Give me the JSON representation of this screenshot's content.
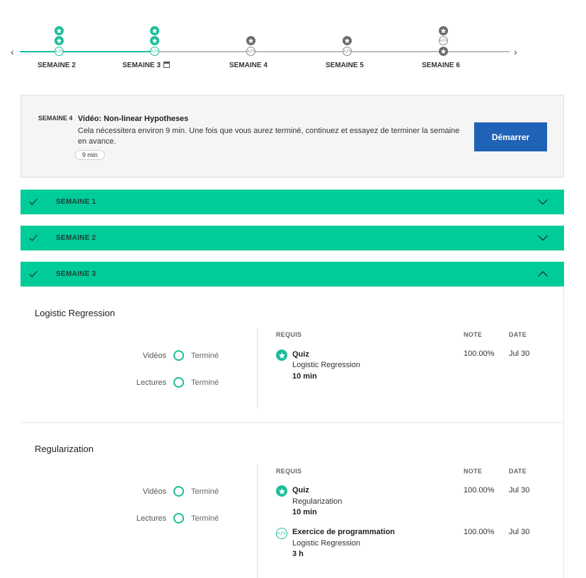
{
  "timeline": {
    "weeks": [
      {
        "label": "SEMAINE 2",
        "status": "done"
      },
      {
        "label": "SEMAINE 3",
        "status": "current"
      },
      {
        "label": "SEMAINE 4",
        "status": "todo"
      },
      {
        "label": "SEMAINE 5",
        "status": "todo"
      },
      {
        "label": "SEMAINE 6",
        "status": "todo"
      }
    ],
    "prev_arrow": "‹",
    "next_arrow": "›"
  },
  "next_item": {
    "week": "SEMAINE 4",
    "title": "Vidéo: Non-linear Hypotheses",
    "description": "Cela nécessitera environ 9  min. Une fois que vous aurez terminé, continuez et essayez de terminer la semaine en avance.",
    "duration": "9  min",
    "start_button": "Démarrer"
  },
  "weeks": [
    {
      "label": "SEMAINE 1",
      "expanded": false
    },
    {
      "label": "SEMAINE 2",
      "expanded": false
    },
    {
      "label": "SEMAINE 3",
      "expanded": true
    }
  ],
  "lessons": [
    {
      "title": "Logistic Regression",
      "progress": [
        {
          "label": "Vidéos",
          "status": "Terminé"
        },
        {
          "label": "Lectures",
          "status": "Terminé"
        }
      ],
      "headers": {
        "required": "REQUIS",
        "grade": "NOTE",
        "date": "DATE"
      },
      "items": [
        {
          "icon": "quiz-star-icon",
          "type": "Quiz",
          "name": "Logistic Regression",
          "duration": "10  min",
          "grade": "100.00%",
          "date": "Jul 30"
        }
      ]
    },
    {
      "title": "Regularization",
      "progress": [
        {
          "label": "Vidéos",
          "status": "Terminé"
        },
        {
          "label": "Lectures",
          "status": "Terminé"
        }
      ],
      "headers": {
        "required": "REQUIS",
        "grade": "NOTE",
        "date": "DATE"
      },
      "items": [
        {
          "icon": "quiz-star-icon",
          "type": "Quiz",
          "name": "Regularization",
          "duration": "10  min",
          "grade": "100.00%",
          "date": "Jul 30"
        },
        {
          "icon": "code-icon",
          "type": "Exercice de programmation",
          "name": "Logistic Regression",
          "duration": "3 h",
          "grade": "100.00%",
          "date": "Jul 30"
        }
      ]
    }
  ],
  "colors": {
    "accent": "#00cc99",
    "icon_green": "#1cbd9b",
    "button_blue": "#2062b6"
  }
}
